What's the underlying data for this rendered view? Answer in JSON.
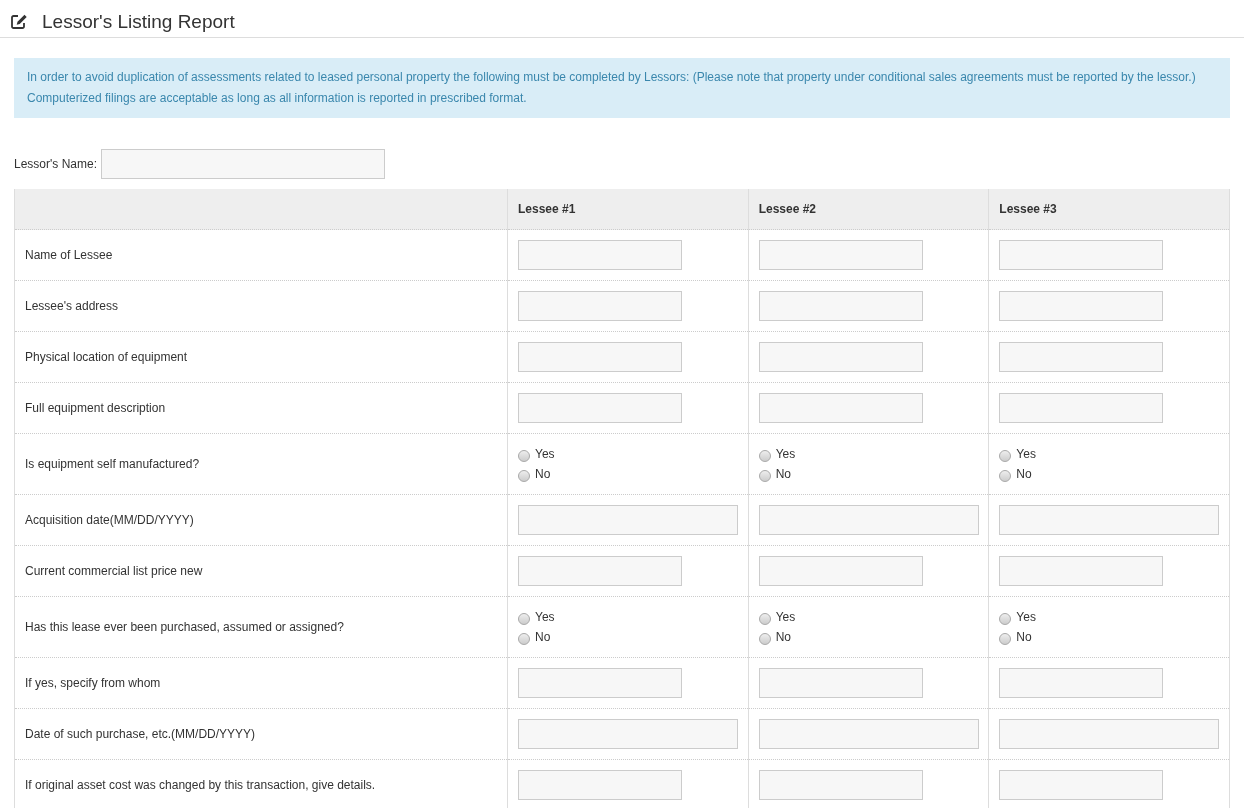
{
  "page_title": "Lessor's Listing Report",
  "notice": "In order to avoid duplication of assessments related to leased personal property the following must be completed by Lessors: (Please note that property under conditional sales agreements must be reported by the lessor.) Computerized filings are acceptable as long as all information is reported in prescribed format.",
  "lessor_name": {
    "label": "Lessor's Name:"
  },
  "table": {
    "columns": [
      "Lessee #1",
      "Lessee #2",
      "Lessee #3"
    ],
    "rows": [
      {
        "label": "Name of Lessee",
        "kind": "text"
      },
      {
        "label": "Lessee's address",
        "kind": "text"
      },
      {
        "label": "Physical location of equipment",
        "kind": "text"
      },
      {
        "label": "Full equipment description",
        "kind": "text"
      },
      {
        "label": "Is equipment self manufactured?",
        "kind": "radio",
        "cells": [
          {
            "options": [
              {
                "label": "Yes",
                "selected": false
              },
              {
                "label": "No",
                "selected": false
              }
            ]
          },
          {
            "options": [
              {
                "label": "Yes",
                "selected": false
              },
              {
                "label": "No",
                "selected": false
              }
            ]
          },
          {
            "options": [
              {
                "label": "Yes",
                "selected": false
              },
              {
                "label": "No",
                "selected": false
              }
            ]
          }
        ]
      },
      {
        "label": "Acquisition date(MM/DD/YYYY)",
        "kind": "date"
      },
      {
        "label": "Current commercial list price new",
        "kind": "text"
      },
      {
        "label": "Has this lease ever been purchased, assumed or assigned?",
        "kind": "radio",
        "cells": [
          {
            "options": [
              {
                "label": "Yes",
                "selected": false
              },
              {
                "label": "No",
                "selected": false
              }
            ]
          },
          {
            "options": [
              {
                "label": "Yes",
                "selected": false
              },
              {
                "label": "No",
                "selected": false
              }
            ]
          },
          {
            "options": [
              {
                "label": "Yes",
                "selected": false
              },
              {
                "label": "No",
                "selected": false
              }
            ]
          }
        ]
      },
      {
        "label": "If yes, specify from whom",
        "kind": "text"
      },
      {
        "label": "Date of such purchase, etc.(MM/DD/YYYY)",
        "kind": "date"
      },
      {
        "label": "If original asset cost was changed by this transaction, give details.",
        "kind": "text"
      }
    ]
  }
}
